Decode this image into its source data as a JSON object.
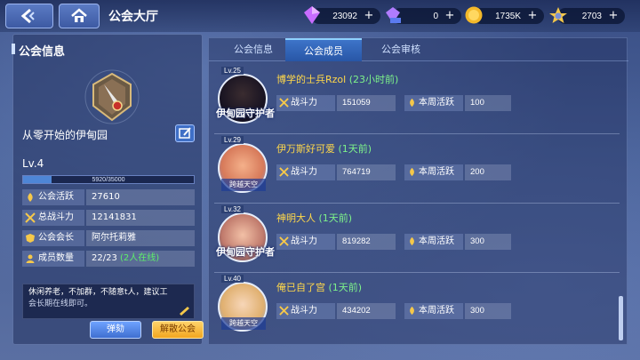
{
  "header": {
    "title": "公会大厅",
    "resources": [
      {
        "icon": "crystal-icon",
        "value": "23092"
      },
      {
        "icon": "vip-gem-icon",
        "value": "0"
      },
      {
        "icon": "gold-coin-icon",
        "value": "1735K"
      },
      {
        "icon": "star-medal-icon",
        "value": "2703"
      }
    ]
  },
  "left": {
    "heading": "公会信息",
    "guild_name": "从零开始的伊甸园",
    "level": "Lv.4",
    "xp_text": "5920/35000",
    "xp_fraction": 0.169,
    "stats": [
      {
        "label": "公会活跃",
        "value": "27610",
        "icon": "flame-icon"
      },
      {
        "label": "总战斗力",
        "value": "12141831",
        "icon": "swords-icon"
      },
      {
        "label": "公会会长",
        "value": "阿尔托莉雅",
        "icon": "crown-shield-icon"
      },
      {
        "label": "成员数量",
        "value": "22/23",
        "extra": "(2人在线)",
        "icon": "members-icon"
      }
    ],
    "notice_line1": "休闲养老，不加群，不随意t人，建议工",
    "notice_line2": "会长期在线即可。",
    "kick_label": "弹劾",
    "disband_label": "解散公会"
  },
  "tabs": [
    "公会信息",
    "公会成员",
    "公会审核"
  ],
  "active_tab": 1,
  "members": [
    {
      "level": "Lv.25",
      "name": "博学的士兵Rzol",
      "time": "(23小时前)",
      "badge": "伊甸园守护者",
      "badge_style": "large",
      "power_label": "战斗力",
      "power": "151059",
      "activity_label": "本周活跃",
      "activity": "100"
    },
    {
      "level": "Lv.29",
      "name": "伊万斯好可爱",
      "time": "(1天前)",
      "badge": "跨越天空",
      "badge_style": "small",
      "power_label": "战斗力",
      "power": "764719",
      "activity_label": "本周活跃",
      "activity": "200"
    },
    {
      "level": "Lv.32",
      "name": "神明大人",
      "time": "(1天前)",
      "badge": "伊甸园守护者",
      "badge_style": "large",
      "power_label": "战斗力",
      "power": "819282",
      "activity_label": "本周活跃",
      "activity": "300"
    },
    {
      "level": "Lv.40",
      "name": "俺已自了宫",
      "time": "(1天前)",
      "badge": "跨越天空",
      "badge_style": "small",
      "power_label": "战斗力",
      "power": "434202",
      "activity_label": "本周活跃",
      "activity": "300"
    }
  ],
  "colors": {
    "accent": "#3d74c9",
    "name": "#ffd84a",
    "time": "#7df28a",
    "online": "#5df06a"
  }
}
